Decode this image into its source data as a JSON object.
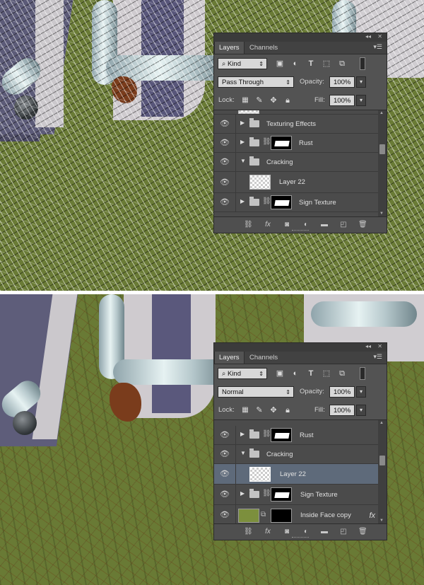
{
  "panel_top": {
    "tabs": [
      "Layers",
      "Channels"
    ],
    "filter": "Kind",
    "blend_mode": "Pass Through",
    "opacity_label": "Opacity:",
    "opacity": "100%",
    "lock_label": "Lock:",
    "fill_label": "Fill:",
    "fill": "100%",
    "layers": [
      {
        "name": "Texturing Effects",
        "type": "group",
        "expanded": false
      },
      {
        "name": "Rust",
        "type": "group",
        "expanded": false,
        "mask": true
      },
      {
        "name": "Cracking",
        "type": "group",
        "expanded": true
      },
      {
        "name": "Layer 22",
        "type": "layer",
        "selected": false
      },
      {
        "name": "Sign Texture",
        "type": "group",
        "expanded": false,
        "mask": true
      }
    ]
  },
  "panel_bottom": {
    "tabs": [
      "Layers",
      "Channels"
    ],
    "filter": "Kind",
    "blend_mode": "Normal",
    "opacity_label": "Opacity:",
    "opacity": "100%",
    "lock_label": "Lock:",
    "fill_label": "Fill:",
    "fill": "100%",
    "layers": [
      {
        "name": "Rust",
        "type": "group",
        "expanded": false,
        "mask": true
      },
      {
        "name": "Cracking",
        "type": "group",
        "expanded": true
      },
      {
        "name": "Layer 22",
        "type": "layer",
        "selected": true
      },
      {
        "name": "Sign Texture",
        "type": "group",
        "expanded": false,
        "mask": true
      },
      {
        "name": "Inside Face copy",
        "type": "smart",
        "fx": "fx"
      }
    ]
  },
  "icons": {
    "visibility": "eye-icon",
    "group": "folder-icon",
    "link": "chain-icon",
    "footer": [
      "link-layers-icon",
      "fx-icon",
      "add-mask-icon",
      "adjustment-icon",
      "new-group-icon",
      "new-layer-icon",
      "trash-icon"
    ]
  },
  "colors": {
    "panel_bg": "#535353",
    "selected_row": "#5e6a7a",
    "canvas_olive": "#697a35"
  }
}
